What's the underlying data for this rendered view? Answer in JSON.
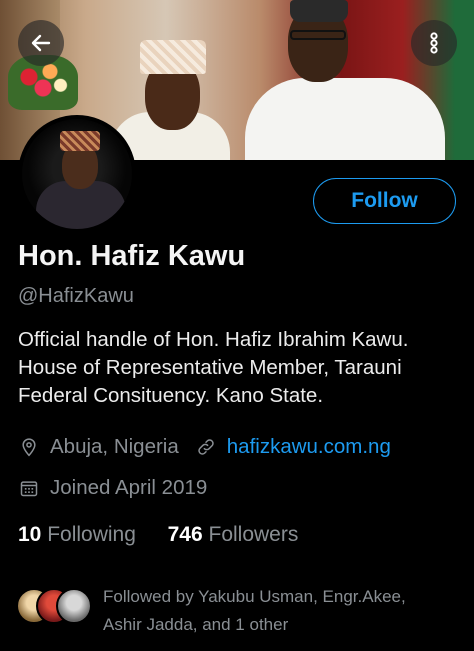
{
  "profile": {
    "name": "Hon. Hafiz Kawu",
    "handle": "@HafizKawu",
    "bio_lines": [
      "Official handle of Hon. Hafiz Ibrahim Kawu.",
      "House of Representative Member, Tarauni",
      "Federal Consituency. Kano State."
    ],
    "location": "Abuja, Nigeria",
    "website": "hafizkawu.com.ng",
    "joined": "Joined April 2019",
    "following_count": "10",
    "following_label": "Following",
    "followers_count": "746",
    "followers_label": "Followers"
  },
  "actions": {
    "follow_label": "Follow"
  },
  "followed_by": {
    "line1": "Followed by Yakubu Usman, Engr.Akee,",
    "line2": "Ashir Jadda, and 1 other"
  },
  "icons": {
    "back": "arrow-left-icon",
    "menu": "more-vertical-icon",
    "location": "location-pin-icon",
    "link": "link-icon",
    "calendar": "calendar-icon"
  },
  "colors": {
    "accent": "#1d9bf0",
    "background": "#000000",
    "secondary_text": "#8a8f94"
  }
}
